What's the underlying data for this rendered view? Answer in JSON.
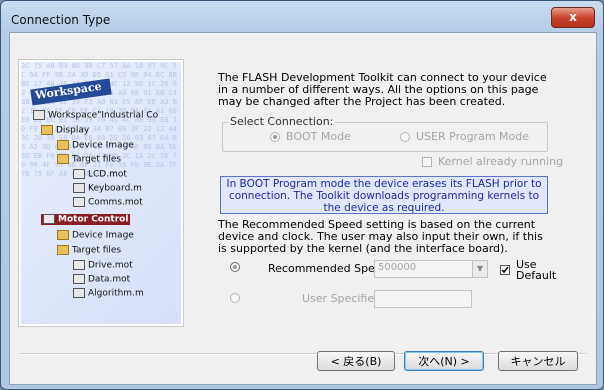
{
  "window": {
    "title": "Connection Type",
    "close_glyph": "x"
  },
  "image_panel": {
    "workspace_label": "Workspace",
    "hex_text": "3C 75 4B B3 8D 3B C7 57 AA 1B 97 9C 5C DA FF 5B 2A 3D D5 61 C5 9F 94 EC BB BD 17 48 46 A6 9E F7 4C 12 9D 1C 26 02 4B 8C 4D D7 00 66 76 A0 08 91 EB C4 3B F1 16 1E 33 F3 A0 61 E5 8F DD A3 B2 11 8D 6F F8 EE CA 10 38 9A 81 A1 68 E0 B1 EC B1 58 39 76 41 4C 80 98 E8 1D F8 23 A1 29 9A 34 B7 80 3F 22 12 44 3C 20 39 E8 8A E6 80 5E 56 03 47 E4 B3 A2 9D 02 41 8D 12 15 1E AE 90 DA 5E 5D EB F8 98 D4 D4 44 8D 3C 1A 2C 56 79 98 4F 95 0B 6F 21 F0 58 F0 9E 2A 7F 70 75 6F A8 04 B0 B5 2F",
    "tree": [
      {
        "label": "Workspace\"Industrial Co",
        "kind": "root"
      },
      {
        "label": "Display",
        "kind": "folder"
      },
      {
        "label": "Device Image",
        "kind": "folder"
      },
      {
        "label": "Target files",
        "kind": "folder"
      },
      {
        "label": "LCD.mot",
        "kind": "file"
      },
      {
        "label": "Keyboard.m",
        "kind": "file"
      },
      {
        "label": "Comms.mot",
        "kind": "file"
      },
      {
        "label": "Motor Control",
        "kind": "highlight"
      },
      {
        "label": "Device Image",
        "kind": "folder"
      },
      {
        "label": "Target files",
        "kind": "folder"
      },
      {
        "label": "Drive.mot",
        "kind": "file"
      },
      {
        "label": "Data.mot",
        "kind": "file"
      },
      {
        "label": "Algorithm.m",
        "kind": "file"
      }
    ]
  },
  "intro_text": "The FLASH Development Toolkit can connect to your device in a number of different ways. All the options on this page may be changed after the Project has been created.",
  "select_connection": {
    "label": "Select Connection:",
    "boot_mode": "BOOT Mode",
    "user_mode": "USER Program Mode",
    "kernel_running": "Kernel already running"
  },
  "notice_text": "In BOOT Program mode the device erases its FLASH prior to connection. The Toolkit downloads programming kernels to the device as required.",
  "speed_text": "The Recommended Speed setting is based on the current device and clock. The user may also input their own, if this is supported by the kernel (and the interface board).",
  "speeds": {
    "recommended_label": "Recommended Speeds:",
    "recommended_value": "500000",
    "use_default_line1": "Use",
    "use_default_line2": "Default",
    "user_specified_label": "User Specified:"
  },
  "buttons": {
    "back": "< 戻る(B)",
    "next": "次へ(N) >",
    "cancel": "キャンセル"
  }
}
